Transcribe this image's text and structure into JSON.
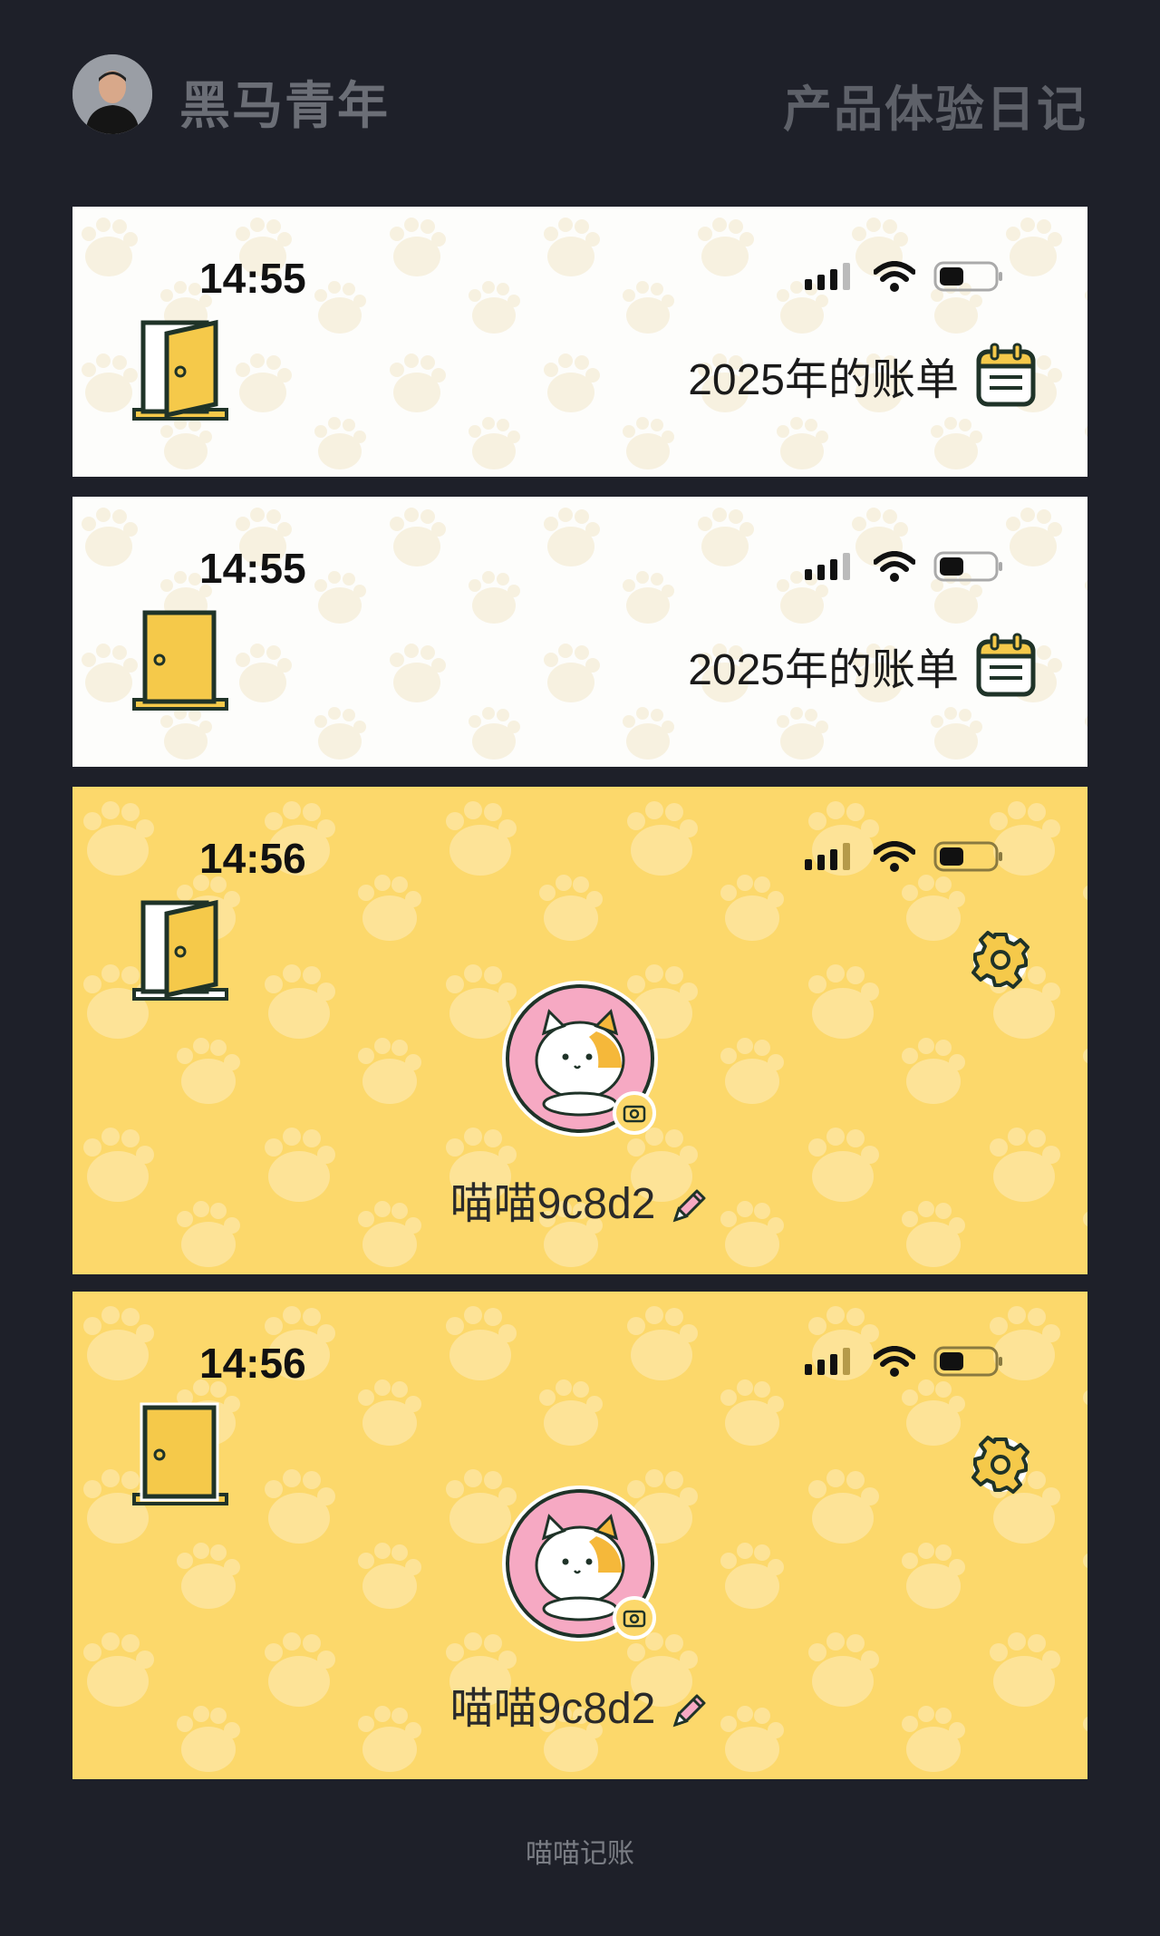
{
  "header": {
    "brand": "黑马青年",
    "title": "产品体验日记"
  },
  "panels": [
    {
      "time": "14:55",
      "bill_label": "2025年的账单",
      "door_state": "open"
    },
    {
      "time": "14:55",
      "bill_label": "2025年的账单",
      "door_state": "closed"
    },
    {
      "time": "14:56",
      "nickname": "喵喵9c8d2",
      "door_state": "open"
    },
    {
      "time": "14:56",
      "nickname": "喵喵9c8d2",
      "door_state": "closed"
    }
  ],
  "footer": "喵喵记账",
  "colors": {
    "background": "#1e2029",
    "panel_yellow": "#fcd86b",
    "avatar_pink": "#f6a9c3"
  },
  "icons": [
    "signal-icon",
    "wifi-icon",
    "battery-icon",
    "door-icon",
    "calendar-icon",
    "gear-icon",
    "camera-icon",
    "pencil-icon"
  ]
}
